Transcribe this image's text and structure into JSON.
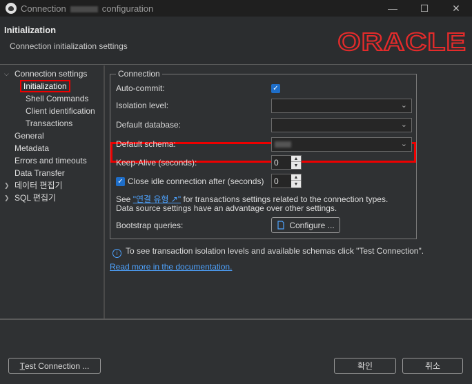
{
  "window": {
    "title_prefix": "Connection",
    "title_suffix": "configuration",
    "minimize": "—",
    "maximize": "☐",
    "close": "✕"
  },
  "header": {
    "title": "Initialization",
    "subtitle": "Connection initialization settings",
    "logo_text": "ORACLE",
    "brand_color": "#e52b2b"
  },
  "tree": {
    "items": [
      {
        "label": "Connection settings",
        "level": 0,
        "expanded": true
      },
      {
        "label": "Initialization",
        "level": 1,
        "selected": true
      },
      {
        "label": "Shell Commands",
        "level": 1
      },
      {
        "label": "Client identification",
        "level": 1
      },
      {
        "label": "Transactions",
        "level": 1
      },
      {
        "label": "General",
        "level": 0
      },
      {
        "label": "Metadata",
        "level": 0
      },
      {
        "label": "Errors and timeouts",
        "level": 0
      },
      {
        "label": "Data Transfer",
        "level": 0
      },
      {
        "label": "데이터 편집기",
        "level": 0,
        "collapsed": true
      },
      {
        "label": "SQL 편집기",
        "level": 0,
        "collapsed": true
      }
    ]
  },
  "connection": {
    "legend": "Connection",
    "auto_commit_label": "Auto-commit:",
    "auto_commit_checked": true,
    "isolation_label": "Isolation level:",
    "isolation_value": "",
    "default_db_label": "Default database:",
    "default_db_value": "",
    "default_schema_label": "Default schema:",
    "keepalive_label": "Keep-Alive (seconds):",
    "keepalive_value": "0",
    "close_idle_label": "Close idle connection after (seconds)",
    "close_idle_checked": true,
    "close_idle_value": "0",
    "note_see": "See",
    "note_link": "\"연결 유형 ↗\"",
    "note_rest1": "for transactions settings related to the connection types.",
    "note_line2": "Data source settings have an advantage over other settings.",
    "bootstrap_label": "Bootstrap queries:",
    "configure_label": "Configure ..."
  },
  "info": {
    "text": "To see transaction isolation levels and available schemas click \"Test Connection\".",
    "doc_link": "Read more in the documentation."
  },
  "buttons": {
    "test_connection_t": "T",
    "test_connection_rest": "est Connection ...",
    "ok": "확인",
    "cancel": "취소"
  }
}
